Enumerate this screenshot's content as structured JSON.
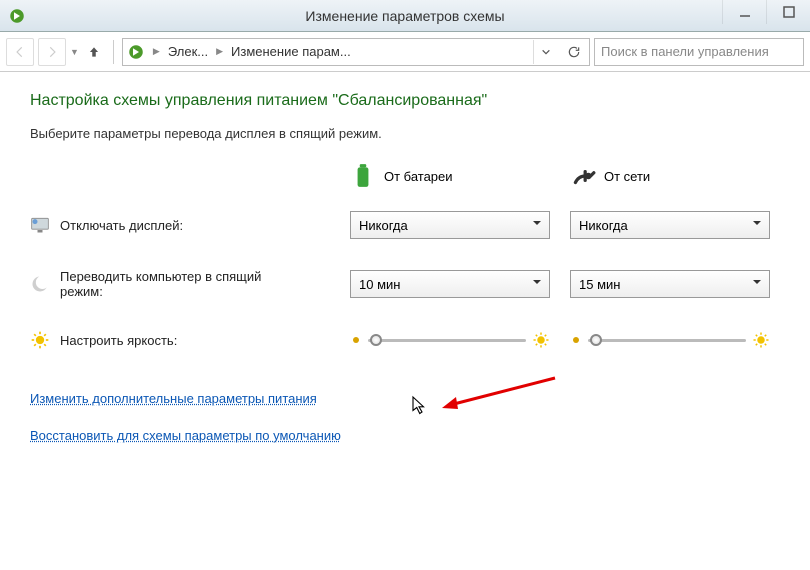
{
  "window": {
    "title": "Изменение параметров схемы"
  },
  "nav": {
    "crumb1": "Элек...",
    "crumb2": "Изменение парам...",
    "search_placeholder": "Поиск в панели управления"
  },
  "heading": "Настройка схемы управления питанием \"Сбалансированная\"",
  "subheading": "Выберите параметры перевода дисплея в спящий режим.",
  "columns": {
    "battery": "От батареи",
    "plugged": "От сети"
  },
  "settings": {
    "display_off": {
      "label": "Отключать дисплей:",
      "battery": "Никогда",
      "plugged": "Никогда"
    },
    "sleep": {
      "label": "Переводить компьютер в спящий режим:",
      "battery": "10 мин",
      "plugged": "15 мин"
    },
    "brightness": {
      "label": "Настроить яркость:"
    }
  },
  "links": {
    "advanced": "Изменить дополнительные параметры питания",
    "restore": "Восстановить для схемы параметры по умолчанию"
  }
}
